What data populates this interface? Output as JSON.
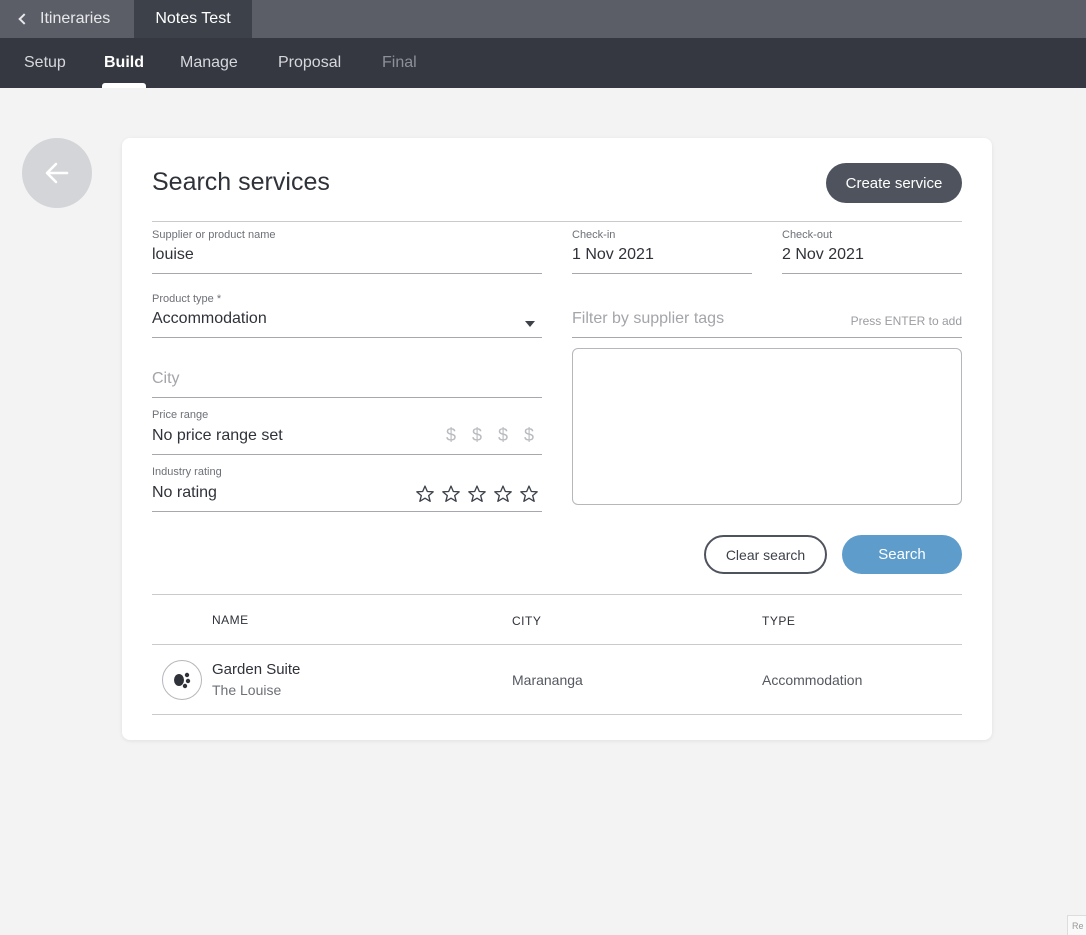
{
  "tabs": {
    "back_label": "Itineraries",
    "active_label": "Notes Test"
  },
  "nav": {
    "setup": "Setup",
    "build": "Build",
    "manage": "Manage",
    "proposal": "Proposal",
    "final": "Final",
    "active": "Build"
  },
  "search": {
    "title": "Search services",
    "create_button": "Create service",
    "supplier_label": "Supplier or product name",
    "supplier_value": "louise",
    "checkin_label": "Check-in",
    "checkin_value": "1 Nov 2021",
    "checkout_label": "Check-out",
    "checkout_value": "2 Nov 2021",
    "product_type_label": "Product type *",
    "product_type_value": "Accommodation",
    "tags_placeholder": "Filter by supplier tags",
    "tags_hint": "Press ENTER to add",
    "city_placeholder": "City",
    "price_label": "Price range",
    "price_value": "No price range set",
    "price_symbols": [
      "$",
      "$",
      "$",
      "$"
    ],
    "rating_label": "Industry rating",
    "rating_value": "No rating",
    "rating_stars": 0,
    "rating_max": 5,
    "clear_button": "Clear search",
    "search_button": "Search"
  },
  "results": {
    "columns": {
      "name": "NAME",
      "city": "CITY",
      "type": "TYPE"
    },
    "rows": [
      {
        "name": "Garden Suite",
        "supplier": "The Louise",
        "city": "Marananga",
        "type": "Accommodation",
        "icon": "supplier-logo-icon"
      }
    ]
  },
  "colors": {
    "topbar": "#5b5e67",
    "navbar": "#353841",
    "create_button": "#4e535d",
    "search_button": "#5d9ccb"
  },
  "corner_text": "Re"
}
